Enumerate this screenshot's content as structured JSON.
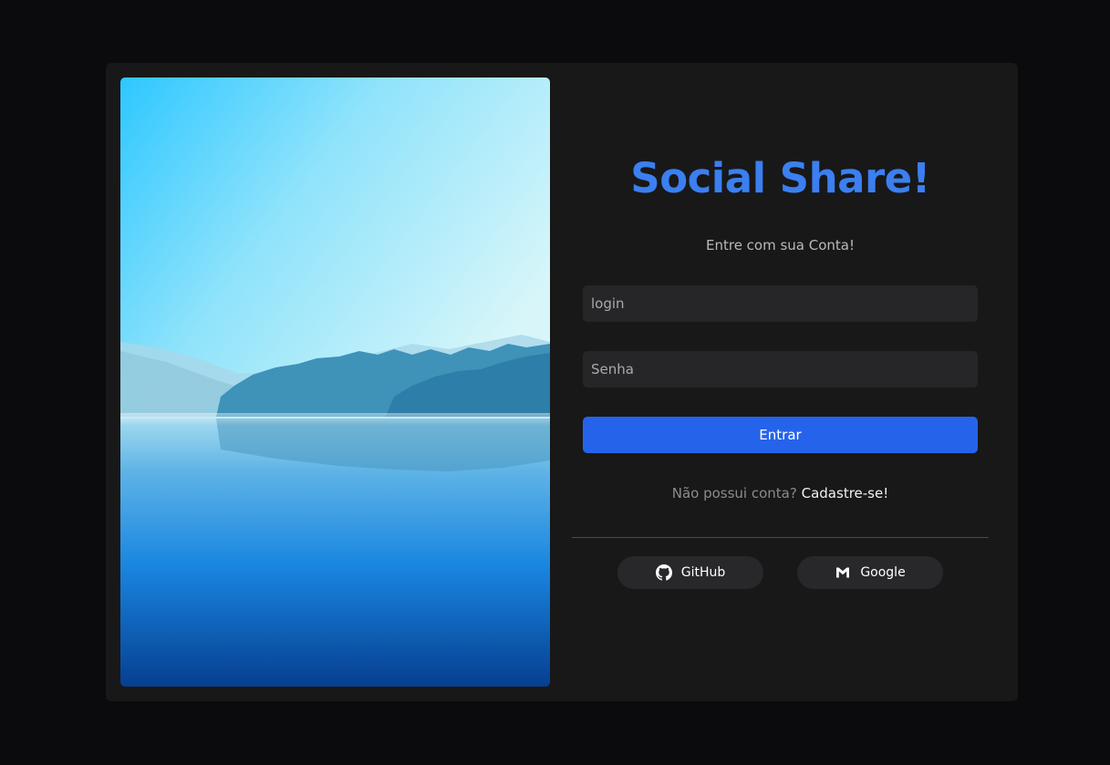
{
  "hero": {
    "image": "lake-and-forested-hills-landscape"
  },
  "form": {
    "title": "Social Share!",
    "subtitle": "Entre com sua Conta!",
    "login_placeholder": "login",
    "password_placeholder": "Senha",
    "submit_label": "Entrar",
    "signup_prompt": "Não possui conta?",
    "signup_link": "Cadastre-se!"
  },
  "social": {
    "github": {
      "label": "GitHub",
      "icon": "github-icon"
    },
    "google": {
      "label": "Google",
      "icon": "gmail-icon"
    }
  },
  "colors": {
    "page_background": "#0b0b0d",
    "card_background": "#181819",
    "title": "#3b7ff0",
    "primary_button": "#2563eb",
    "input_background": "#262629"
  }
}
